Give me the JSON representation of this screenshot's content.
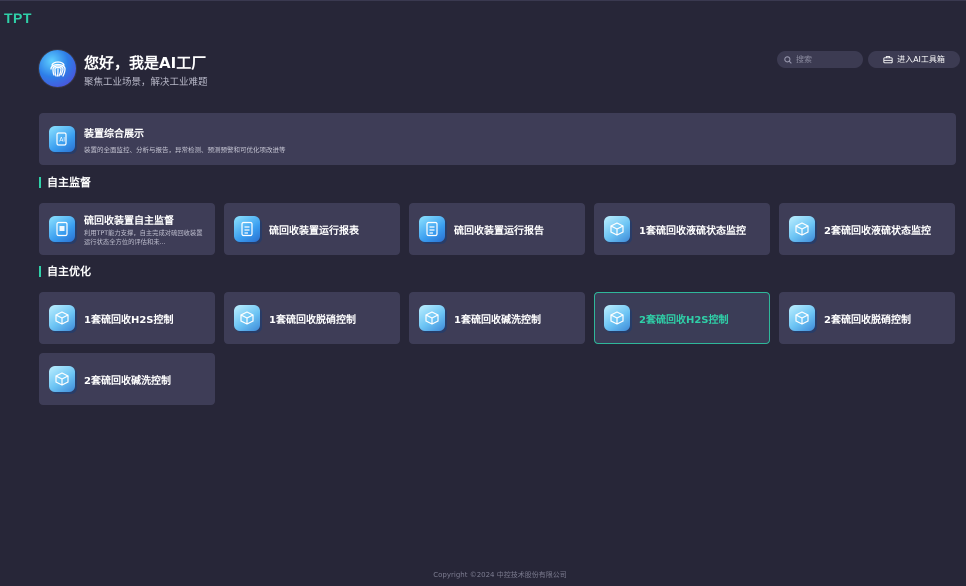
{
  "app": {
    "logo": "TPT"
  },
  "header": {
    "title": "您好，我是AI工厂",
    "subtitle": "聚焦工业场景，解决工业难题",
    "search_placeholder": "搜索",
    "toolbox_label": "进入AI工具箱"
  },
  "banner": {
    "title": "装置综合展示",
    "desc": "装置的全面监控、分析与报告，异常检测、预测预警和可优化项改进等"
  },
  "sections": {
    "monitor": {
      "title": "自主监督",
      "cards": [
        {
          "label": "硫回收装置自主监督",
          "sub": "利用TPT能力支撑，自主完成对硫回收装置运行状态全方位的评估和未..."
        },
        {
          "label": "硫回收装置运行报表"
        },
        {
          "label": "硫回收装置运行报告"
        },
        {
          "label": "1套硫回收液硫状态监控"
        },
        {
          "label": "2套硫回收液硫状态监控"
        }
      ]
    },
    "optimize": {
      "title": "自主优化",
      "cards": [
        {
          "label": "1套硫回收H2S控制"
        },
        {
          "label": "1套硫回收脱硝控制"
        },
        {
          "label": "1套硫回收碱洗控制"
        },
        {
          "label": "2套硫回收H2S控制"
        },
        {
          "label": "2套硫回收脱硝控制"
        },
        {
          "label": "2套硫回收碱洗控制"
        }
      ]
    }
  },
  "footer": {
    "copyright": "Copyright ©2024 中控技术股份有限公司"
  },
  "colors": {
    "accent": "#2fd0a8",
    "card_bg": "#3e3d57",
    "page_bg": "#272638"
  }
}
